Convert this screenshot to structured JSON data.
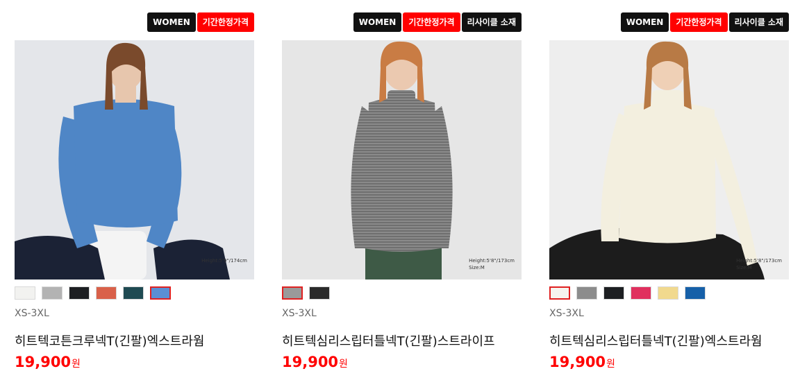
{
  "products": [
    {
      "badges": [
        {
          "label": "WOMEN",
          "style": "black"
        },
        {
          "label": "기간한정가격",
          "style": "red"
        }
      ],
      "image": {
        "background": "#e4e6ea",
        "garment_color": "#4f86c6",
        "model_height": "Height:5'9\"/174cm",
        "model_size": ""
      },
      "swatches": [
        {
          "color": "#f2f2f0",
          "selected": false
        },
        {
          "color": "#b3b3b3",
          "selected": false
        },
        {
          "color": "#1d1f22",
          "selected": false
        },
        {
          "color": "#d9614a",
          "selected": false
        },
        {
          "color": "#1f4a52",
          "selected": false
        },
        {
          "color": "#5a8fd4",
          "selected": true
        }
      ],
      "sizes": "XS-3XL",
      "name": "히트텍코튼크루넥T(긴팔)엑스트라웜",
      "price": "19,900",
      "currency": "원"
    },
    {
      "badges": [
        {
          "label": "WOMEN",
          "style": "black"
        },
        {
          "label": "기간한정가격",
          "style": "red"
        },
        {
          "label": "리사이클 소재",
          "style": "black"
        }
      ],
      "image": {
        "background": "#e6e6e6",
        "garment_color": "#7a7a7a",
        "model_height": "Height:5'8\"/173cm",
        "model_size": "Size:M"
      },
      "swatches": [
        {
          "color": "#9a9a9a",
          "selected": true
        },
        {
          "color": "#2a2a2a",
          "selected": false
        }
      ],
      "sizes": "XS-3XL",
      "name": "히트텍심리스립터틀넥T(긴팔)스트라이프",
      "price": "19,900",
      "currency": "원"
    },
    {
      "badges": [
        {
          "label": "WOMEN",
          "style": "black"
        },
        {
          "label": "기간한정가격",
          "style": "red"
        },
        {
          "label": "리사이클 소재",
          "style": "black"
        }
      ],
      "image": {
        "background": "#eeeeee",
        "garment_color": "#f3efdf",
        "model_height": "Height:5'8\"/173cm",
        "model_size": "Size:M"
      },
      "swatches": [
        {
          "color": "#f6f4ee",
          "selected": true
        },
        {
          "color": "#8c8c8c",
          "selected": false
        },
        {
          "color": "#1d1f22",
          "selected": false
        },
        {
          "color": "#e0305e",
          "selected": false
        },
        {
          "color": "#f1d98e",
          "selected": false
        },
        {
          "color": "#1660a8",
          "selected": false
        }
      ],
      "sizes": "XS-3XL",
      "name": "히트텍심리스립터틀넥T(긴팔)엑스트라웜",
      "price": "19,900",
      "currency": "원"
    }
  ]
}
